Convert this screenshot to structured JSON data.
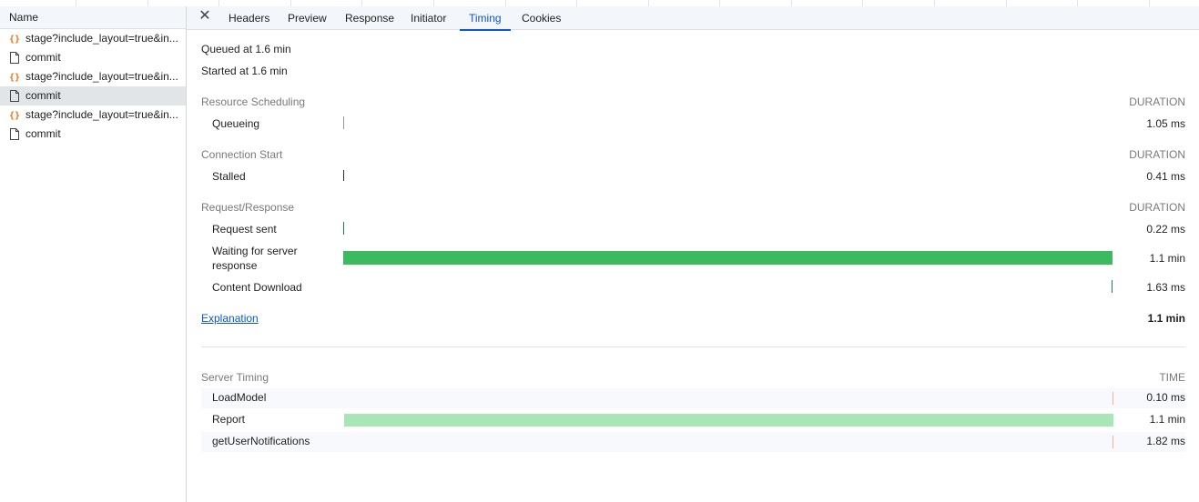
{
  "request_list": {
    "header": "Name",
    "items": [
      {
        "label": "stage?include_layout=true&in...",
        "type": "fetch-icon",
        "selected": false
      },
      {
        "label": "commit",
        "type": "document-icon",
        "selected": false
      },
      {
        "label": "stage?include_layout=true&in...",
        "type": "fetch-icon",
        "selected": false
      },
      {
        "label": "commit",
        "type": "document-icon",
        "selected": true
      },
      {
        "label": "stage?include_layout=true&in...",
        "type": "fetch-icon",
        "selected": false
      },
      {
        "label": "commit",
        "type": "document-icon",
        "selected": false
      }
    ]
  },
  "tabs": {
    "close_icon": "close-icon",
    "headers": "Headers",
    "preview": "Preview",
    "response": "Response",
    "initiator": "Initiator",
    "timing": "Timing",
    "cookies": "Cookies",
    "active": "Timing"
  },
  "timing": {
    "queued_at": "Queued at 1.6 min",
    "started_at": "Started at 1.6 min",
    "duration_header": "DURATION",
    "sections": {
      "resource_scheduling": {
        "title": "Resource Scheduling",
        "queueing": {
          "label": "Queueing",
          "value": "1.05 ms"
        }
      },
      "connection_start": {
        "title": "Connection Start",
        "stalled": {
          "label": "Stalled",
          "value": "0.41 ms"
        }
      },
      "request_response": {
        "title": "Request/Response",
        "request_sent": {
          "label": "Request sent",
          "value": "0.22 ms"
        },
        "waiting": {
          "label": "Waiting for server response",
          "value": "1.1 min"
        },
        "content_download": {
          "label": "Content Download",
          "value": "1.63 ms"
        }
      }
    },
    "explanation_link": "Explanation",
    "total": "1.1 min"
  },
  "server_timing": {
    "title": "Server Timing",
    "time_header": "TIME",
    "rows": [
      {
        "label": "LoadModel",
        "value": "0.10 ms"
      },
      {
        "label": "Report",
        "value": "1.1 min"
      },
      {
        "label": "getUserNotifications",
        "value": "1.82 ms"
      }
    ]
  },
  "colors": {
    "accent": "#0b57d0",
    "waiting_bar": "#3cba60",
    "report_bar": "#a8e6b8",
    "fetch_icon": "#e8711a",
    "selected_row": "#e2e5e8"
  }
}
